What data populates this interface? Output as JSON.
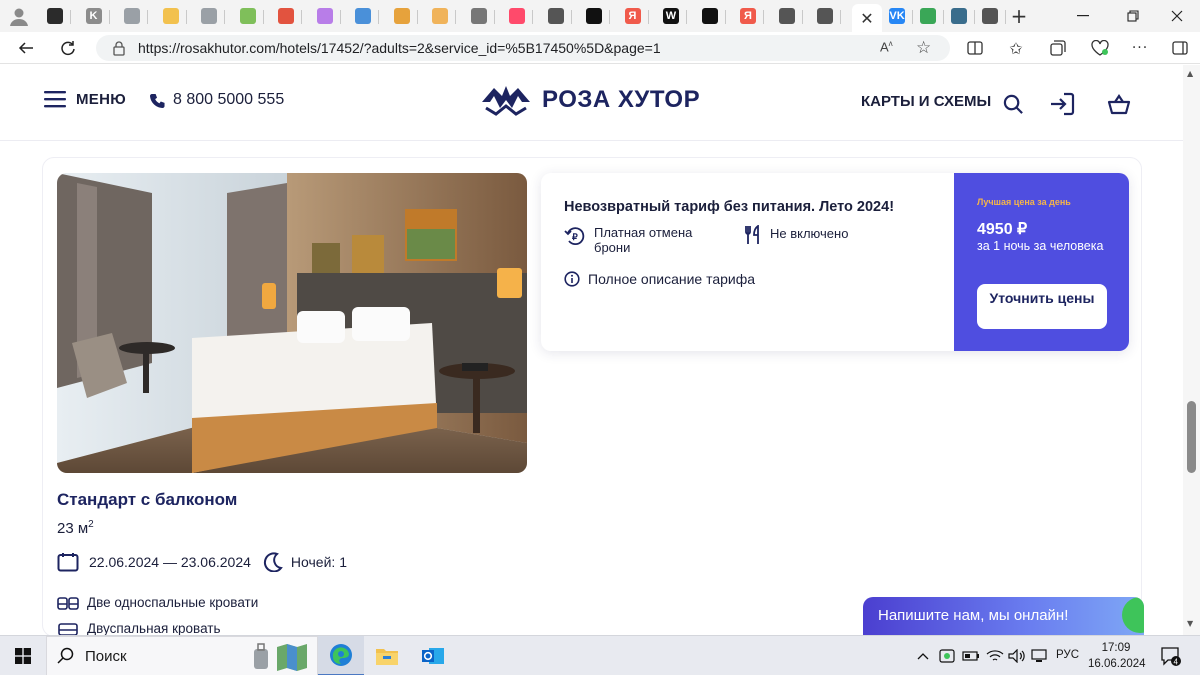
{
  "browser": {
    "tabs": [
      {
        "name": "tab-1",
        "letter": "",
        "color": "#2b2b2b"
      },
      {
        "name": "tab-2",
        "letter": "K",
        "color": "#8c8c8c"
      },
      {
        "name": "tab-3",
        "letter": "",
        "color": "#9aa0a6"
      },
      {
        "name": "tab-4",
        "letter": "",
        "color": "#f2c14e"
      },
      {
        "name": "tab-5",
        "letter": "",
        "color": "#9aa0a6"
      },
      {
        "name": "tab-6",
        "letter": "",
        "color": "#7fbf5a"
      },
      {
        "name": "tab-7",
        "letter": "",
        "color": "#e2533f"
      },
      {
        "name": "tab-8",
        "letter": "",
        "color": "#b87de8"
      },
      {
        "name": "tab-9",
        "letter": "",
        "color": "#4a90d9"
      },
      {
        "name": "tab-10",
        "letter": "",
        "color": "#e6a23c"
      },
      {
        "name": "tab-11",
        "letter": "",
        "color": "#f0b35a"
      },
      {
        "name": "tab-12",
        "letter": "",
        "color": "#777777"
      },
      {
        "name": "tab-13",
        "letter": "",
        "color": "#ff4a6b"
      },
      {
        "name": "tab-14",
        "letter": "",
        "color": "#555555"
      },
      {
        "name": "tab-15",
        "letter": "",
        "color": "#111111"
      },
      {
        "name": "tab-16",
        "letter": "Я",
        "color": "#f05a4b"
      },
      {
        "name": "tab-17",
        "letter": "W",
        "color": "#111111"
      },
      {
        "name": "tab-18",
        "letter": "",
        "color": "#111111"
      },
      {
        "name": "tab-19",
        "letter": "Я",
        "color": "#f05a4b"
      },
      {
        "name": "tab-20",
        "letter": "",
        "color": "#555555"
      },
      {
        "name": "tab-21",
        "letter": "",
        "color": "#555555"
      }
    ],
    "after_tabs": [
      {
        "name": "tab-vk",
        "letter": "VK",
        "color": "#2787f5"
      },
      {
        "name": "tab-gear",
        "letter": "",
        "color": "#3aa757"
      },
      {
        "name": "tab-circle",
        "letter": "",
        "color": "#3a6d8c"
      },
      {
        "name": "tab-plus",
        "letter": "",
        "color": "#555555"
      }
    ],
    "url": "https://rosakhutor.com/hotels/17452/?adults=2&service_id=%5B17450%5D&page=1"
  },
  "site": {
    "menu_label": "МЕНЮ",
    "phone": "8 800 5000 555",
    "logo_text": "РОЗА ХУТОР",
    "maps_label": "КАРТЫ И СХЕМЫ",
    "brand_color": "#1d2460",
    "accent_color": "#4f4ee0"
  },
  "room": {
    "title": "Стандарт с балконом",
    "area": "23 м",
    "area_sup": "2",
    "dates": "22.06.2024 — 23.06.2024",
    "nights": "Ночей: 1",
    "beds": [
      "Две односпальные кровати",
      "Двуспальная кровать"
    ],
    "gallery": {
      "count": 6,
      "active_index": 0
    }
  },
  "tariff": {
    "name": "Невозвратный тариф без питания. Лето 2024!",
    "cancellation": "Платная отмена брони",
    "meals": "Не включено",
    "description_link": "Полное описание тарифа",
    "best_price_label": "Лучшая цена за день",
    "price": "4950 ₽",
    "price_note": "за 1 ночь за человека",
    "cta": "Уточнить цены"
  },
  "chat": {
    "label": "Напишите нам, мы онлайн!"
  },
  "taskbar": {
    "search_label": "Поиск",
    "language": "РУС",
    "time": "17:09",
    "date": "16.06.2024",
    "notifications": "4"
  }
}
